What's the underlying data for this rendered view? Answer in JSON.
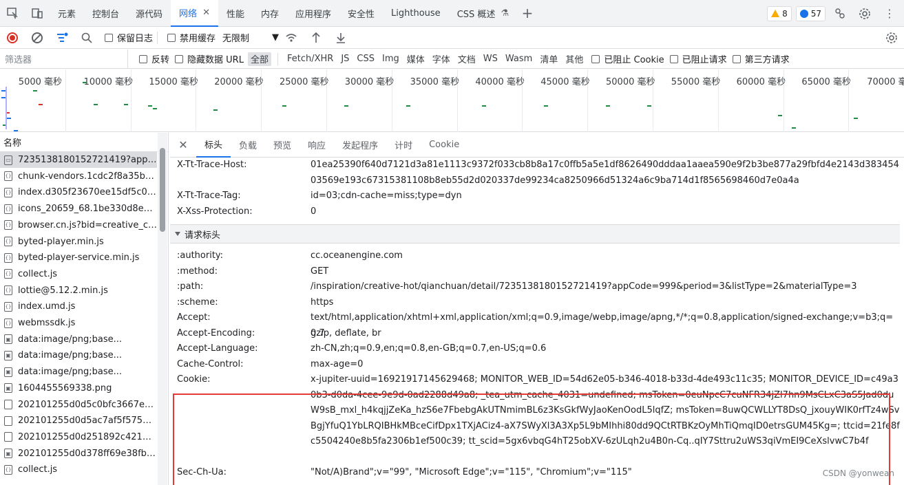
{
  "tabs": [
    {
      "label": "元素"
    },
    {
      "label": "控制台"
    },
    {
      "label": "源代码"
    },
    {
      "label": "网络",
      "active": true
    },
    {
      "label": "性能"
    },
    {
      "label": "内存"
    },
    {
      "label": "应用程序"
    },
    {
      "label": "安全性"
    },
    {
      "label": "Lighthouse"
    },
    {
      "label": "CSS 概述"
    }
  ],
  "badges": {
    "warnings": "8",
    "messages": "57"
  },
  "toolbar": {
    "preserve_log": "保留日志",
    "disable_cache": "禁用缓存",
    "throttle": "无限制"
  },
  "filter": {
    "placeholder": "筛选器",
    "invert": "反转",
    "hide_data_url": "隐藏数据 URL",
    "chips": [
      "全部",
      "Fetch/XHR",
      "JS",
      "CSS",
      "Img",
      "媒体",
      "字体",
      "文档",
      "WS",
      "Wasm",
      "清单",
      "其他"
    ],
    "blocked_cookies": "已阻止 Cookie",
    "blocked_requests": "已阻止请求",
    "third_party": "第三方请求"
  },
  "overview": {
    "ticks": [
      "5000 毫秒",
      "10000 毫秒",
      "15000 毫秒",
      "20000 毫秒",
      "25000 毫秒",
      "30000 毫秒",
      "35000 毫秒",
      "40000 毫秒",
      "45000 毫秒",
      "50000 毫秒",
      "55000 毫秒",
      "60000 毫秒",
      "65000 毫秒",
      "70000 毫秒"
    ]
  },
  "request_list": {
    "header": "名称",
    "items": [
      {
        "name": "7235138180152721419?appCo...",
        "icon": "document-icon",
        "selected": true
      },
      {
        "name": "chunk-vendors.1cdc2f8a35b99f...",
        "icon": "script-icon"
      },
      {
        "name": "index.d305f23670ee15df5c0f.js",
        "icon": "script-icon"
      },
      {
        "name": "icons_20659_68.1be330d8e052...",
        "icon": "script-icon"
      },
      {
        "name": "browser.cn.js?bid=creative_cent...",
        "icon": "script-icon"
      },
      {
        "name": "byted-player.min.js",
        "icon": "script-icon"
      },
      {
        "name": "byted-player-service.min.js",
        "icon": "script-icon"
      },
      {
        "name": "collect.js",
        "icon": "script-icon"
      },
      {
        "name": "lottie@5.12.2.min.js",
        "icon": "script-icon"
      },
      {
        "name": "index.umd.js",
        "icon": "script-icon"
      },
      {
        "name": "webmssdk.js",
        "icon": "script-icon"
      },
      {
        "name": "data:image/png;base...",
        "icon": "image-icon"
      },
      {
        "name": "data:image/png;base...",
        "icon": "image-icon"
      },
      {
        "name": "data:image/png;base...",
        "icon": "image-icon"
      },
      {
        "name": "1604455569338.png",
        "icon": "image-icon"
      },
      {
        "name": "202101255d0d5c0bfc3667e047...",
        "icon": "file-icon"
      },
      {
        "name": "202101255d0d5ac7af5f5755457...",
        "icon": "file-icon"
      },
      {
        "name": "202101255d0d251892c4219941...",
        "icon": "file-icon"
      },
      {
        "name": "202101255d0d378ff69e38fb429...",
        "icon": "image-icon"
      },
      {
        "name": "collect.js",
        "icon": "script-icon"
      }
    ]
  },
  "detail_tabs": [
    "标头",
    "负载",
    "预览",
    "响应",
    "发起程序",
    "计时",
    "Cookie"
  ],
  "response_headers": [
    {
      "key": "X-Tt-Trace-Host:",
      "value": "01ea25390f640d7121d3a81e1113c9372f033cb8b8a17c0ffb5a5e1df8626490dddaa1aaea590e9f2b3be877a29fbfd4e2143d38345403569e193c67315381108b8eb55d2d020337de99234ca8250966d51324a6c9ba714d1f8565698460d7e0a4a"
    },
    {
      "key": "X-Tt-Trace-Tag:",
      "value": "id=03;cdn-cache=miss;type=dyn"
    },
    {
      "key": "X-Xss-Protection:",
      "value": "0"
    }
  ],
  "request_section_title": "请求标头",
  "request_headers": [
    {
      "key": ":authority:",
      "value": "cc.oceanengine.com"
    },
    {
      "key": ":method:",
      "value": "GET"
    },
    {
      "key": ":path:",
      "value": "/inspiration/creative-hot/qianchuan/detail/7235138180152721419?appCode=999&period=3&listType=2&materialType=3"
    },
    {
      "key": ":scheme:",
      "value": "https"
    },
    {
      "key": "Accept:",
      "value": "text/html,application/xhtml+xml,application/xml;q=0.9,image/webp,image/apng,*/*;q=0.8,application/signed-exchange;v=b3;q=0.7"
    },
    {
      "key": "Accept-Encoding:",
      "value": "gzip, deflate, br"
    },
    {
      "key": "Accept-Language:",
      "value": "zh-CN,zh;q=0.9,en;q=0.8,en-GB;q=0.7,en-US;q=0.6"
    },
    {
      "key": "Cache-Control:",
      "value": "max-age=0"
    },
    {
      "key": "Cookie:",
      "value": "x-jupiter-uuid=16921917145629468; MONITOR_WEB_ID=54d62e05-b346-4018-b33d-4de493c11c35; MONITOR_DEVICE_ID=c49a30b3-d0da-4cee-9e9d-0ad2288d49a8; _tea_utm_cache_4031=undefined; msToken=0euNpcC7cuNFR34jZl7hn9MsCLxC3aS5Jad0duW9sB_mxl_h4kqjjZeKa_hzS6e7FbebgAkUTNmimBL6z3KsGkfWyJaoKenOodL5lqfZ; msToken=8uwQCWLLYT8DsQ_jxouyWIK0rfTz4wSvBgjYfuQ1YbLRQIBHkMBceCifDpx1TXjACiz4-aX7SWyXl3A3Xp5L9bMIhhi80dd9QCtRTBKzOyMhTiQmqID0etrsGUM45Kg=; ttcid=21fe8fc5504240e8b5fa2306b1ef500c39; tt_scid=5gx6vbqG4hT25obXV-6zULqh2u4B0n-Cq..qIY7Sttru2uWS3qiVmEI9CeXslvwC7b4f"
    },
    {
      "key": "Sec-Ch-Ua:",
      "value": "\"Not/A)Brand\";v=\"99\", \"Microsoft Edge\";v=\"115\", \"Chromium\";v=\"115\""
    }
  ],
  "watermark": "CSDN @yonwean",
  "colors": {
    "accent": "#1a73e8",
    "record": "#d93025",
    "highlight": "#e53935",
    "warning": "#f9ab00"
  }
}
